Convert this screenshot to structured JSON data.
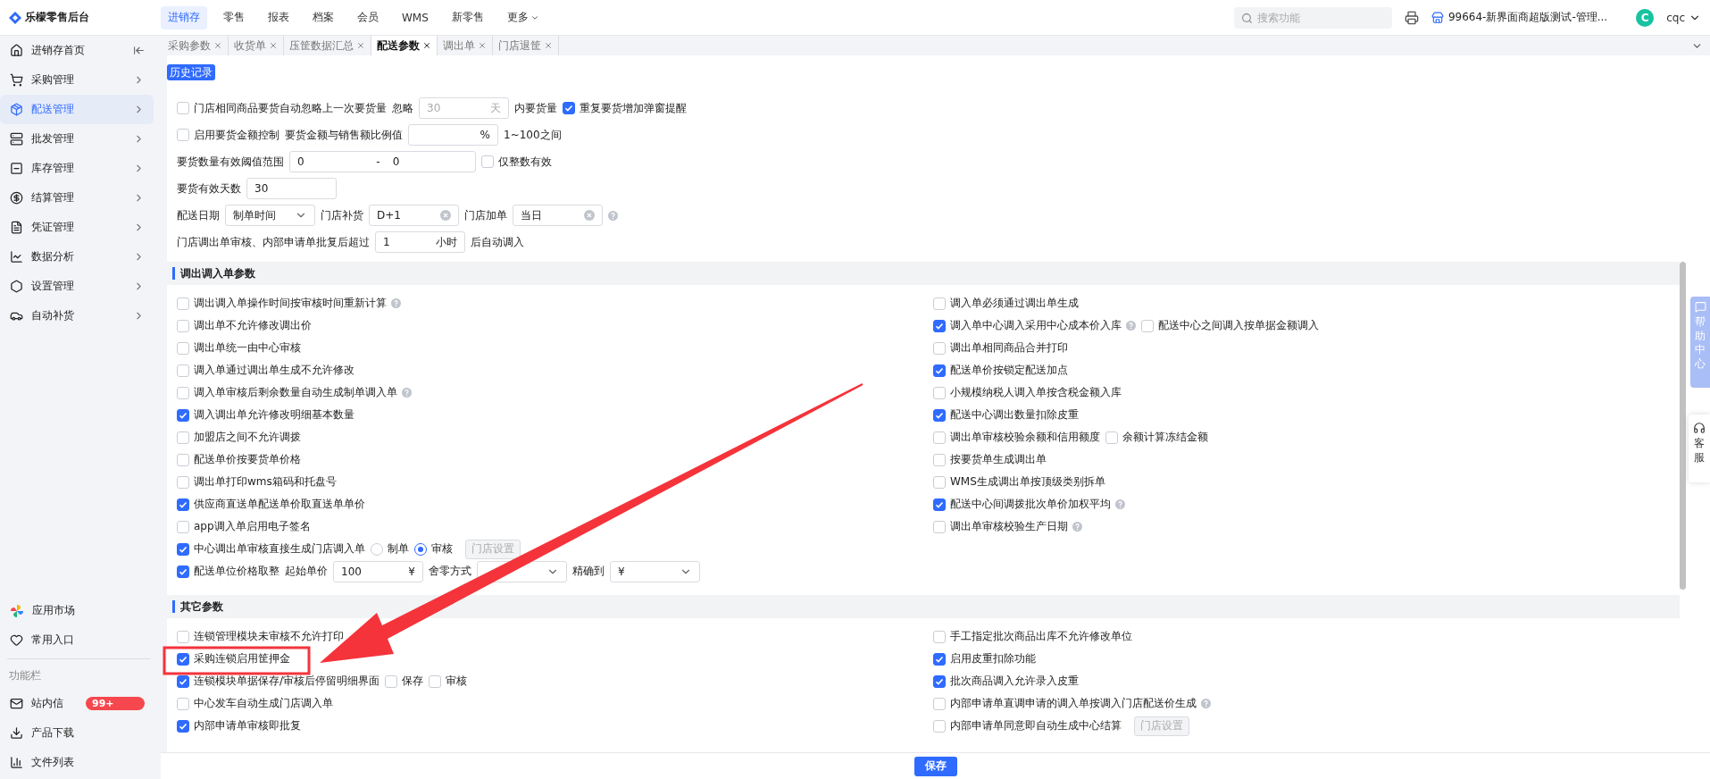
{
  "top_bar": {
    "logo": "乐檬零售后台",
    "nav": [
      {
        "label": "进销存",
        "selected": true
      },
      {
        "label": "零售",
        "selected": false
      },
      {
        "label": "报表",
        "selected": false
      },
      {
        "label": "档案",
        "selected": false
      },
      {
        "label": "会员",
        "selected": false
      },
      {
        "label": "WMS",
        "selected": false
      },
      {
        "label": "新零售",
        "selected": false
      }
    ],
    "more": "更多",
    "search_placeholder": "搜索功能",
    "store": "99664-新界面商超版测试-管理...",
    "user_initial": "C",
    "user_name": "cqc"
  },
  "sidebar": {
    "items": [
      {
        "label": "进销存首页",
        "selected": false
      },
      {
        "label": "采购管理",
        "selected": false
      },
      {
        "label": "配送管理",
        "selected": true
      },
      {
        "label": "批发管理",
        "selected": false
      },
      {
        "label": "库存管理",
        "selected": false
      },
      {
        "label": "结算管理",
        "selected": false
      },
      {
        "label": "凭证管理",
        "selected": false
      },
      {
        "label": "数据分析",
        "selected": false
      },
      {
        "label": "设置管理",
        "selected": false
      },
      {
        "label": "自动补货",
        "selected": false
      }
    ],
    "apps": [
      {
        "label": "应用市场"
      },
      {
        "label": "常用入口"
      }
    ],
    "section_label": "功能栏",
    "tools": [
      {
        "label": "站内信",
        "badge": "99+"
      },
      {
        "label": "产品下载"
      },
      {
        "label": "文件列表"
      }
    ]
  },
  "tabs": [
    {
      "label": "采购参数",
      "selected": false
    },
    {
      "label": "收货单",
      "selected": false
    },
    {
      "label": "压筐数据汇总",
      "selected": false
    },
    {
      "label": "配送参数",
      "selected": true
    },
    {
      "label": "调出单",
      "selected": false
    },
    {
      "label": "门店退筐",
      "selected": false
    }
  ],
  "history_button": "历史记录",
  "general_rows": [
    [
      {
        "kind": "checkbox",
        "label": "门店相同商品要货自动忽略上一次要货量",
        "checked": false
      },
      {
        "kind": "text",
        "text": "忽略"
      },
      {
        "kind": "input",
        "value": "30",
        "suffix": "天",
        "disabled": true
      },
      {
        "kind": "text",
        "text": "内要货量"
      },
      {
        "kind": "checkbox",
        "label": "重复要货增加弹窗提醒",
        "checked": true
      }
    ],
    [
      {
        "kind": "checkbox",
        "label": "启用要货金额控制",
        "checked": false
      },
      {
        "kind": "text",
        "text": "要货金额与销售额比例值"
      },
      {
        "kind": "input",
        "suffix": "%"
      },
      {
        "kind": "text",
        "text": "1~100之间"
      }
    ],
    [
      {
        "kind": "text",
        "text": "要货数量有效阈值范围"
      },
      {
        "kind": "range",
        "from": "0",
        "separator": "-",
        "to": "0"
      },
      {
        "kind": "checkbox",
        "label": "仅整数有效",
        "checked": false
      }
    ],
    [
      {
        "kind": "text",
        "text": "要货有效天数"
      },
      {
        "kind": "input",
        "value": "30"
      }
    ],
    [
      {
        "kind": "text",
        "text": "配送日期"
      },
      {
        "kind": "select",
        "value": "制单时间"
      },
      {
        "kind": "text",
        "text": "门店补货"
      },
      {
        "kind": "select",
        "value": "D+1",
        "clearable": true
      },
      {
        "kind": "text",
        "text": "门店加单"
      },
      {
        "kind": "select",
        "value": "当日",
        "clearable": true
      },
      {
        "kind": "help"
      }
    ],
    [
      {
        "kind": "text",
        "text": "门店调出单审核、内部申请单批复后超过"
      },
      {
        "kind": "input",
        "value": "1",
        "suffix": "小时"
      },
      {
        "kind": "text",
        "text": "后自动调入"
      }
    ]
  ],
  "sections": [
    {
      "title": "调出调入单参数",
      "left": [
        [
          {
            "kind": "checkbox",
            "label": "调出调入单操作时间按审核时间重新计算",
            "checked": false,
            "help": true
          }
        ],
        [
          {
            "kind": "checkbox",
            "label": "调出单不允许修改调出价",
            "checked": false
          }
        ],
        [
          {
            "kind": "checkbox",
            "label": "调出单统一由中心审核",
            "checked": false
          }
        ],
        [
          {
            "kind": "checkbox",
            "label": "调入单通过调出单生成不允许修改",
            "checked": false
          }
        ],
        [
          {
            "kind": "checkbox",
            "label": "调入单审核后剩余数量自动生成制单调入单",
            "checked": false,
            "help": true
          }
        ],
        [
          {
            "kind": "checkbox",
            "label": "调入调出单允许修改明细基本数量",
            "checked": true
          }
        ],
        [
          {
            "kind": "checkbox",
            "label": "加盟店之间不允许调拨",
            "checked": false
          }
        ],
        [
          {
            "kind": "checkbox",
            "label": "配送单价按要货单价格",
            "checked": false
          }
        ],
        [
          {
            "kind": "checkbox",
            "label": "调出单打印wms箱码和托盘号",
            "checked": false
          }
        ],
        [
          {
            "kind": "checkbox",
            "label": "供应商直送单配送单价取直送单单价",
            "checked": true
          }
        ],
        [
          {
            "kind": "checkbox",
            "label": "app调入单启用电子签名",
            "checked": false
          }
        ],
        [
          {
            "kind": "checkbox",
            "label": "中心调出单审核直接生成门店调入单",
            "checked": true
          },
          {
            "kind": "radio",
            "label": "制单",
            "selected": false
          },
          {
            "kind": "radio",
            "label": "审核",
            "selected": true
          },
          {
            "kind": "button",
            "label": "门店设置",
            "disabled": true
          }
        ],
        [
          {
            "kind": "checkbox",
            "label": "配送单位价格取整",
            "checked": true
          },
          {
            "kind": "text",
            "text": "起始单价"
          },
          {
            "kind": "input",
            "value": "100",
            "suffix": "¥"
          },
          {
            "kind": "text",
            "text": "舍零方式"
          },
          {
            "kind": "select"
          },
          {
            "kind": "text",
            "text": "精确到"
          },
          {
            "kind": "select",
            "value": "¥"
          }
        ]
      ],
      "right": [
        [
          {
            "kind": "checkbox",
            "label": "调入单必须通过调出单生成",
            "checked": false
          }
        ],
        [
          {
            "kind": "checkbox",
            "label": "调入单中心调入采用中心成本价入库",
            "checked": true,
            "help": true
          },
          {
            "kind": "checkbox",
            "label": "配送中心之间调入按单据金额调入",
            "checked": false
          }
        ],
        [
          {
            "kind": "checkbox",
            "label": "调出单相同商品合并打印",
            "checked": false
          }
        ],
        [
          {
            "kind": "checkbox",
            "label": "配送单价按锁定配送加点",
            "checked": true
          }
        ],
        [
          {
            "kind": "checkbox",
            "label": "小规模纳税人调入单按含税金额入库",
            "checked": false
          }
        ],
        [
          {
            "kind": "checkbox",
            "label": "配送中心调出数量扣除皮重",
            "checked": true
          }
        ],
        [
          {
            "kind": "checkbox",
            "label": "调出单审核校验余额和信用额度",
            "checked": false
          },
          {
            "kind": "checkbox",
            "label": "余额计算冻结金额",
            "checked": false
          }
        ],
        [
          {
            "kind": "checkbox",
            "label": "按要货单生成调出单",
            "checked": false
          }
        ],
        [
          {
            "kind": "checkbox",
            "label": "WMS生成调出单按顶级类别拆单",
            "checked": false
          }
        ],
        [
          {
            "kind": "checkbox",
            "label": "配送中心间调拨批次单价加权平均",
            "checked": true,
            "help": true
          }
        ],
        [
          {
            "kind": "checkbox",
            "label": "调出单审核校验生产日期",
            "checked": false,
            "help": true
          }
        ]
      ]
    },
    {
      "title": "其它参数",
      "left": [
        [
          {
            "kind": "checkbox",
            "label": "连锁管理模块未审核不允许打印",
            "checked": false
          }
        ],
        [
          {
            "kind": "checkbox",
            "label": "采购连锁启用筐押金",
            "checked": true
          }
        ],
        [
          {
            "kind": "checkbox",
            "label": "连锁模块单据保存/审核后停留明细界面",
            "checked": true
          },
          {
            "kind": "checkbox",
            "label": "保存",
            "checked": false
          },
          {
            "kind": "checkbox",
            "label": "审核",
            "checked": false
          }
        ],
        [
          {
            "kind": "checkbox",
            "label": "中心发车自动生成门店调入单",
            "checked": false
          }
        ],
        [
          {
            "kind": "checkbox",
            "label": "内部申请单审核即批复",
            "checked": true
          }
        ]
      ],
      "right": [
        [
          {
            "kind": "checkbox",
            "label": "手工指定批次商品出库不允许修改单位",
            "checked": false
          }
        ],
        [
          {
            "kind": "checkbox",
            "label": "启用皮重扣除功能",
            "checked": true
          }
        ],
        [
          {
            "kind": "checkbox",
            "label": "批次商品调入允许录入皮重",
            "checked": true
          }
        ],
        [
          {
            "kind": "checkbox",
            "label": "内部申请单直调申请的调入单按调入门店配送价生成",
            "checked": false,
            "help": true
          }
        ],
        [
          {
            "kind": "checkbox",
            "label": "内部申请单同意即自动生成中心结算",
            "checked": false
          },
          {
            "kind": "button",
            "label": "门店设置",
            "disabled": true
          }
        ]
      ]
    }
  ],
  "save_button": "保存",
  "help_center": "帮助中心",
  "service": "客服"
}
